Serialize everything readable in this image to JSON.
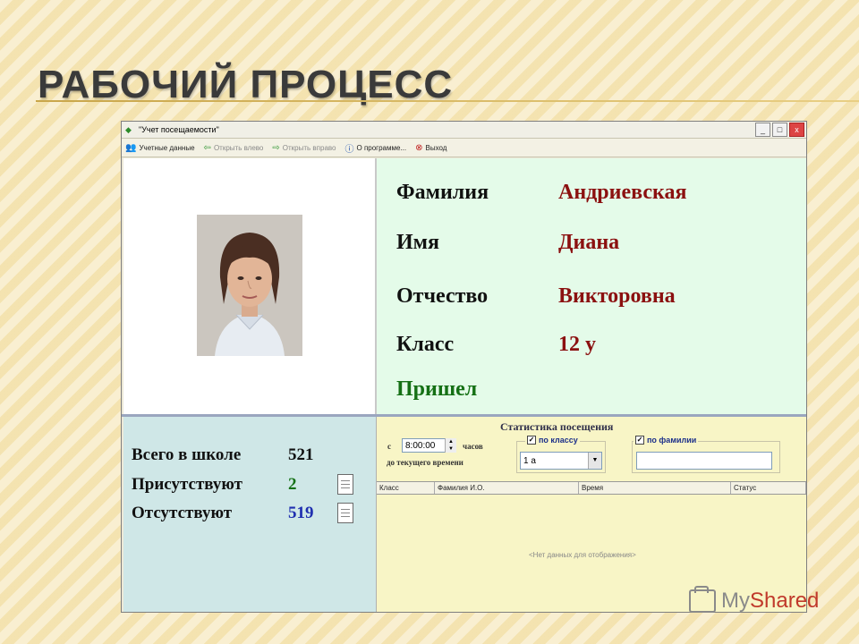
{
  "slide": {
    "title": "РАБОЧИЙ ПРОЦЕСС"
  },
  "window": {
    "title": "\"Учет посещаемости\"",
    "controls": {
      "minimize": "_",
      "maximize": "□",
      "close": "x"
    }
  },
  "toolbar": {
    "items": [
      {
        "label": "Учетные данные",
        "icon": "users-icon",
        "enabled": true
      },
      {
        "label": "Открыть влево",
        "icon": "arrow-left-icon",
        "enabled": false
      },
      {
        "label": "Открыть вправо",
        "icon": "arrow-right-icon",
        "enabled": false
      },
      {
        "label": "О программе...",
        "icon": "info-icon",
        "enabled": true
      },
      {
        "label": "Выход",
        "icon": "exit-icon",
        "enabled": true
      }
    ]
  },
  "student": {
    "surname_label": "Фамилия",
    "surname": "Андриевская",
    "name_label": "Имя",
    "name": "Диана",
    "patronymic_label": "Отчество",
    "patronymic": "Викторовна",
    "class_label": "Класс",
    "class": "12 у",
    "status": "Пришел"
  },
  "stats": {
    "total_label": "Всего в школе",
    "total": "521",
    "present_label": "Присутствуют",
    "present": "2",
    "absent_label": "Отсутствуют",
    "absent": "519"
  },
  "filter": {
    "title": "Статистика посещения",
    "from_label": "с",
    "time": "8:00:00",
    "hours_label": "часов",
    "until_label": "до текущего времени",
    "by_class_label": "по классу",
    "class_value": "1 а",
    "by_surname_label": "по фамилии",
    "surname_value": ""
  },
  "grid": {
    "columns": [
      "Класс",
      "Фамилия И.О.",
      "Время",
      "Статус"
    ],
    "empty_text": "<Нет данных для отображения>"
  },
  "watermark": {
    "part1": "My",
    "part2": "Shared"
  },
  "colors": {
    "value_red": "#8b1010",
    "status_green": "#157015",
    "present_green": "#157015",
    "absent_blue": "#1f2fb0"
  }
}
